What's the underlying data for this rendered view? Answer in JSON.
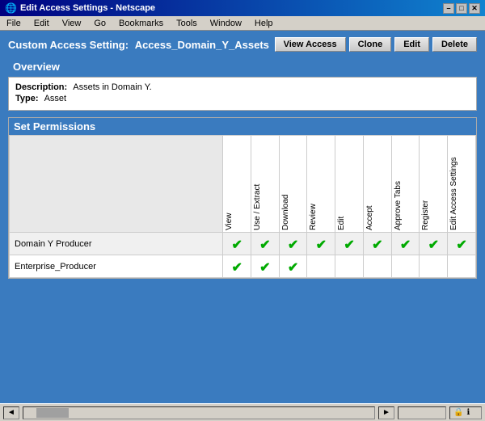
{
  "window": {
    "title": "Edit Access Settings - Netscape"
  },
  "menubar": {
    "items": [
      "File",
      "Edit",
      "View",
      "Go",
      "Bookmarks",
      "Tools",
      "Window",
      "Help"
    ]
  },
  "header": {
    "prefix": "Custom Access Setting:",
    "name": "Access_Domain_Y_Assets"
  },
  "toolbar": {
    "view_access": "View Access",
    "clone": "Clone",
    "edit": "Edit",
    "delete": "Delete"
  },
  "overview": {
    "section_label": "Overview",
    "description_label": "Description:",
    "description_value": "Assets in Domain Y.",
    "type_label": "Type:",
    "type_value": "Asset"
  },
  "permissions": {
    "section_label": "Set Permissions",
    "columns": [
      "View",
      "Use / Extract",
      "Download",
      "Review",
      "Edit",
      "Accept",
      "Approve Tabs",
      "Register",
      "Edit Access Settings"
    ],
    "rows": [
      {
        "label": "Domain Y Producer",
        "checks": [
          true,
          true,
          true,
          true,
          true,
          true,
          true,
          true,
          true
        ]
      },
      {
        "label": "Enterprise_Producer",
        "checks": [
          true,
          true,
          true,
          false,
          false,
          false,
          false,
          false,
          false
        ]
      }
    ]
  },
  "icons": {
    "minimize": "–",
    "maximize": "□",
    "close": "✕",
    "checkmark": "✔",
    "scroll_left": "◄",
    "scroll_right": "►",
    "scroll_up": "▲",
    "scroll_down": "▼"
  }
}
